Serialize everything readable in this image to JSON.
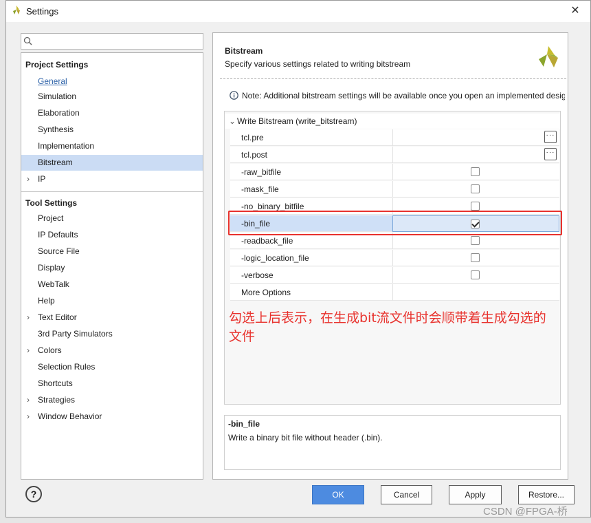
{
  "window": {
    "title": "Settings",
    "close_glyph": "✕"
  },
  "search": {
    "placeholder": "",
    "value": ""
  },
  "left_nav": {
    "project_settings": {
      "title": "Project Settings",
      "items": [
        {
          "label": "General",
          "link": true
        },
        {
          "label": "Simulation"
        },
        {
          "label": "Elaboration"
        },
        {
          "label": "Synthesis"
        },
        {
          "label": "Implementation"
        },
        {
          "label": "Bitstream",
          "selected": true
        },
        {
          "label": "IP",
          "expandable": true
        }
      ]
    },
    "tool_settings": {
      "title": "Tool Settings",
      "items": [
        {
          "label": "Project"
        },
        {
          "label": "IP Defaults"
        },
        {
          "label": "Source File"
        },
        {
          "label": "Display"
        },
        {
          "label": "WebTalk"
        },
        {
          "label": "Help"
        },
        {
          "label": "Text Editor",
          "expandable": true
        },
        {
          "label": "3rd Party Simulators"
        },
        {
          "label": "Colors",
          "expandable": true
        },
        {
          "label": "Selection Rules"
        },
        {
          "label": "Shortcuts"
        },
        {
          "label": "Strategies",
          "expandable": true
        },
        {
          "label": "Window Behavior",
          "expandable": true
        }
      ]
    }
  },
  "panel": {
    "title": "Bitstream",
    "subtitle": "Specify various settings related to writing bitstream",
    "note": "Note: Additional bitstream settings will be available once you open an implemented design.",
    "group": {
      "label": "Write Bitstream (write_bitstream)"
    },
    "rows": {
      "tcl_pre": {
        "name": "tcl.pre"
      },
      "tcl_post": {
        "name": "tcl.post"
      },
      "raw_bitfile": {
        "name": "-raw_bitfile",
        "checked": false
      },
      "mask_file": {
        "name": "-mask_file",
        "checked": false
      },
      "no_binary_bitfile": {
        "name": "-no_binary_bitfile",
        "checked": false
      },
      "bin_file": {
        "name": "-bin_file",
        "checked": true
      },
      "readback_file": {
        "name": "-readback_file",
        "checked": false
      },
      "logic_location_file": {
        "name": "-logic_location_file",
        "checked": false
      },
      "verbose": {
        "name": "-verbose",
        "checked": false
      },
      "more_options": {
        "name": "More Options"
      }
    },
    "annotation": "勾选上后表示，在生成bit流文件时会顺带着生成勾选的文件",
    "description": {
      "title": "-bin_file",
      "text": "Write a binary bit file without header (.bin)."
    }
  },
  "buttons": {
    "help": "?",
    "ok": "OK",
    "cancel": "Cancel",
    "apply": "Apply",
    "restore": "Restore..."
  },
  "watermark": "CSDN @FPGA-桥",
  "colors": {
    "accent": "#4d8be0",
    "selection": "#cbdcf4",
    "annotation": "#e8322d"
  },
  "icons": {
    "app": "vivado-logo-icon",
    "search": "search-icon",
    "info": "info-icon",
    "ellipsis": "ellipsis-icon"
  }
}
